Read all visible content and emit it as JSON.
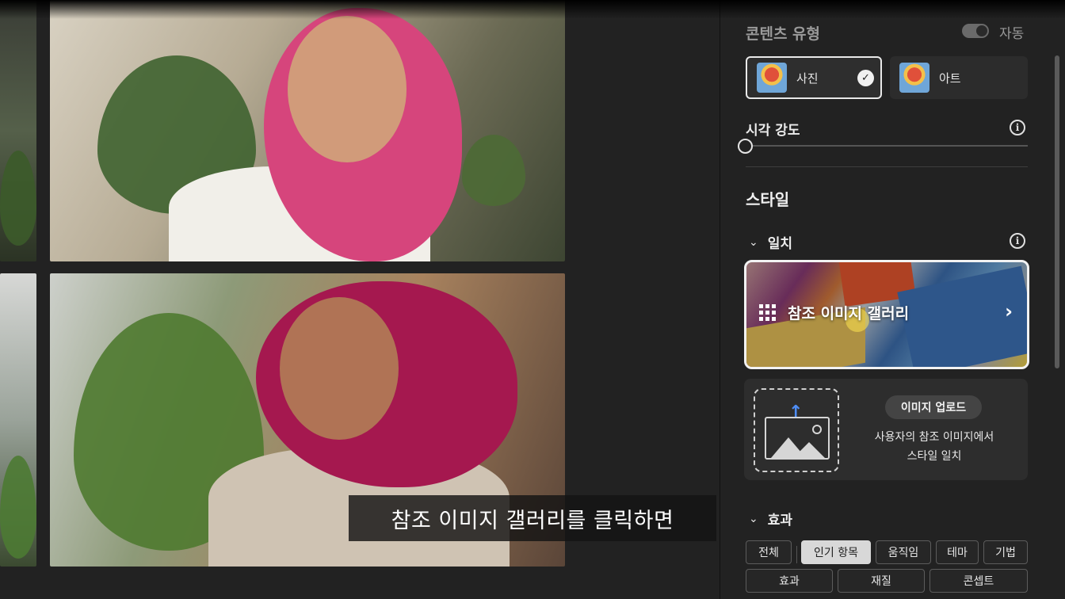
{
  "caption": "참조 이미지 갤러리를 클릭하면",
  "panel": {
    "content_type": {
      "title": "콘텐츠 유형",
      "auto_label": "자동",
      "options": [
        {
          "label": "사진",
          "selected": true
        },
        {
          "label": "아트",
          "selected": false
        }
      ]
    },
    "visual_intensity": {
      "label": "시각 강도",
      "level": 0
    },
    "style": {
      "title": "스타일",
      "match": {
        "label": "일치",
        "gallery_label": "참조 이미지 갤러리",
        "upload_button": "이미지 업로드",
        "upload_desc_line1": "사용자의 참조 이미지에서",
        "upload_desc_line2": "스타일 일치"
      }
    },
    "effects": {
      "label": "효과",
      "chips_row1": [
        "전체",
        "인기 항목",
        "움직임",
        "테마",
        "기법"
      ],
      "chips_row2": [
        "효과",
        "재질",
        "콘셉트"
      ],
      "active_chip": "인기 항목"
    }
  },
  "colors": {
    "panel_bg": "#222222",
    "accent_blue": "#4e8df5",
    "selected_border": "#e9e9e9"
  }
}
